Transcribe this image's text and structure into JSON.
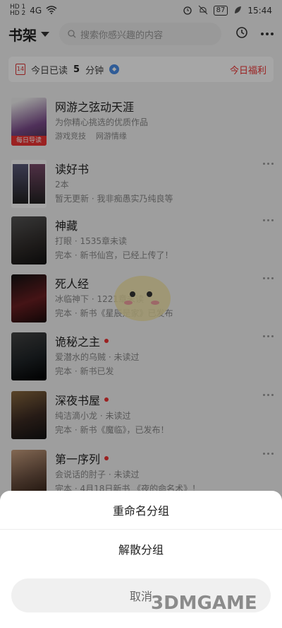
{
  "status": {
    "sim1": "HD 1",
    "sim2": "HD 2",
    "net": "4G",
    "battery": "87",
    "time": "15:44"
  },
  "header": {
    "title": "书架",
    "search_placeholder": "搜索你感兴趣的内容"
  },
  "readbar": {
    "date": "14",
    "prefix": "今日已读",
    "minutes": "5",
    "suffix": "分钟",
    "welfare": "今日福利"
  },
  "books": [
    {
      "name": "网游之弦动天涯",
      "sub": "为你精心挑选的优质作品",
      "tags": [
        "游戏竞技",
        "网游情缘"
      ],
      "guide": "每日导读",
      "cover": "#7a4a8a"
    },
    {
      "name": "读好书",
      "sub": "2本",
      "sub2": "暂无更新 · 我非痴愚实乃纯良等",
      "cover": "#3a3550"
    },
    {
      "name": "神藏",
      "sub": "打眼 · 1535章未读",
      "sub2": "完本 · 新书仙宫，已经上传了！",
      "cover": "#2e2a28"
    },
    {
      "name": "死人经",
      "sub": "冰临神下 · 1221章未读",
      "sub2": "完本 · 新书《星辰是家》已发布",
      "cover": "#6a1f22"
    },
    {
      "name": "诡秘之主",
      "sub": "爱潜水的乌贼 · 未读过",
      "sub2": "完本 · 新书已发",
      "cover": "#1e2326",
      "dot": true
    },
    {
      "name": "深夜书屋",
      "sub": "纯洁滴小龙 · 未读过",
      "sub2": "完本 · 新书《魔临》，已发布！",
      "cover": "#3b2a22",
      "dot": true
    },
    {
      "name": "第一序列",
      "sub": "会说话的肘子 · 未读过",
      "sub2": "完本 · 4月18日新书 《夜的命名术》！",
      "cover": "#6b5040",
      "dot": true
    }
  ],
  "sheet": {
    "rename": "重命名分组",
    "dissolve": "解散分组",
    "cancel": "取消"
  },
  "watermark": "3DMGAME",
  "colors": {
    "accent": "#e33333",
    "bg": "#f3f3f3"
  }
}
